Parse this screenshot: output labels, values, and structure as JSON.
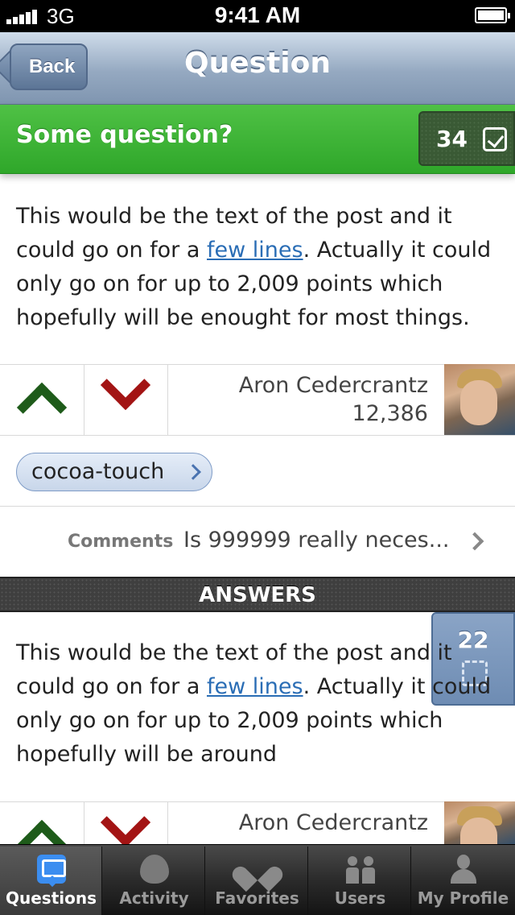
{
  "status_bar": {
    "carrier": "3G",
    "time": "9:41 AM"
  },
  "nav": {
    "back_label": "Back",
    "title": "Question"
  },
  "question": {
    "title": "Some question?",
    "vote_count": "34",
    "body_before_link": "This would be the text of the post and it could go on for a ",
    "link_text": "few lines",
    "body_after_link": ". Actually it could only go on for up to 2,009 points which hopefully will be enought for most things.",
    "author_name": "Aron Cedercrantz",
    "author_reputation": "12,386",
    "tag": "cocoa-touch",
    "comments_label": "Comments",
    "comments_preview": "Is 999999 really neces..."
  },
  "answers": {
    "header": "ANSWERS",
    "items": [
      {
        "vote_count": "22",
        "body_before_link": "This would be the text of the post and it could go on for a ",
        "link_text": "few lines",
        "body_after_link": ". Actually it could only go on for up to 2,009 points which hopefully will be around",
        "author_name": "Aron Cedercrantz"
      }
    ]
  },
  "tab_bar": {
    "tabs": [
      {
        "label": "Questions",
        "icon": "chat-bubble-icon",
        "active": true
      },
      {
        "label": "Activity",
        "icon": "flame-icon",
        "active": false
      },
      {
        "label": "Favorites",
        "icon": "heart-icon",
        "active": false
      },
      {
        "label": "Users",
        "icon": "users-icon",
        "active": false
      },
      {
        "label": "My Profile",
        "icon": "person-icon",
        "active": false
      }
    ]
  },
  "colors": {
    "accent_green": "#2fa72a",
    "nav_blue": "#7f95b0",
    "link_blue": "#2a6db5",
    "upvote": "#1e5b1a",
    "downvote": "#a31414"
  }
}
